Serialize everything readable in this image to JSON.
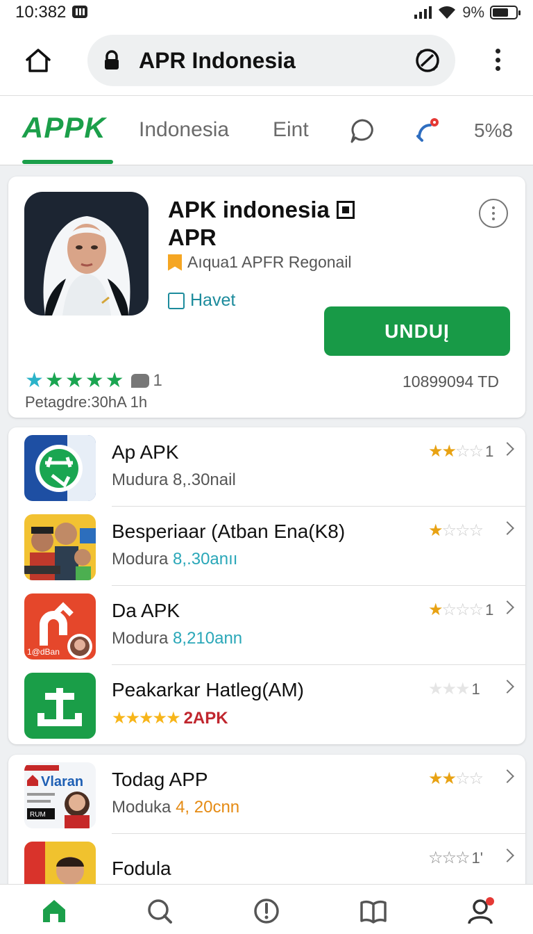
{
  "status_bar": {
    "time": "10:382",
    "battery_text": "9%"
  },
  "url_bar": {
    "url": "APR Indonesia"
  },
  "tabs": {
    "brand": "APPK",
    "items": [
      "Indonesia",
      "Eint"
    ],
    "count": "5%8"
  },
  "featured": {
    "title_line1": "APK indonesia",
    "title_line2": "APR",
    "developer": "Aıqua1 APFR Regonail",
    "badge": "Havet",
    "download_button": "UNDUĮ",
    "rating_count": "1",
    "downloads": "10899094 TD",
    "updated": "Petagdre:30hA 1h",
    "colors": {
      "accent": "#189a47"
    }
  },
  "list": [
    {
      "name": "Ap APK",
      "sub_prefix": "Mudura ",
      "sub_value": "8,.30nail",
      "rating": 2,
      "rating_text": "1"
    },
    {
      "name": "Besperiaar (Atban Ena(K8)",
      "sub_prefix": "Modura ",
      "sub_value": "8,.30anıı",
      "rating": 1,
      "rating_text": ""
    },
    {
      "name": "Da APK",
      "sub_prefix": "Modura ",
      "sub_value": "8,210ann",
      "rating": 1,
      "rating_text": "1"
    },
    {
      "name": "Peakarkar Hatleg(AM)",
      "sub_prefix": "",
      "sub_value": "2APK",
      "rating": 5,
      "rating_text": "1"
    }
  ],
  "list2": [
    {
      "name": "Todag APP",
      "sub_prefix": "Moduka ",
      "sub_value": "4, 20cnn",
      "rating": 2,
      "rating_text": ""
    },
    {
      "name": "Fodula",
      "sub_prefix": "",
      "sub_value": "",
      "rating": 0,
      "rating_text": "1'"
    }
  ],
  "icon_texts": {
    "app3": "1@dBan",
    "app5": "Vlaran",
    "app5_badge": "RUM"
  }
}
